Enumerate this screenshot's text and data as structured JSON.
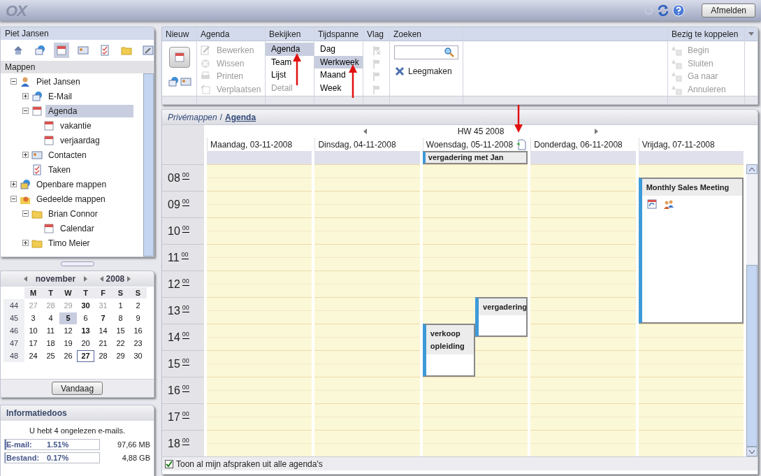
{
  "top_bar": {
    "logo": "OX",
    "logout": "Afmelden"
  },
  "sidebar": {
    "user": "Piet Jansen",
    "modules": [
      {
        "kind": "home",
        "selected": false
      },
      {
        "kind": "mail",
        "selected": false
      },
      {
        "kind": "calendar",
        "selected": true
      },
      {
        "kind": "contacts",
        "selected": false
      },
      {
        "kind": "tasks",
        "selected": false
      },
      {
        "kind": "folder",
        "selected": false
      },
      {
        "kind": "settings",
        "selected": false
      }
    ],
    "folders_title": "Mappen",
    "tree": [
      {
        "label": "Piet Jansen",
        "kind": "user",
        "expanded": true,
        "selected": false,
        "children": [
          {
            "label": "E-Mail",
            "kind": "mail",
            "expanded": false,
            "selected": false
          },
          {
            "label": "Agenda",
            "kind": "calendar",
            "expanded": true,
            "selected": true,
            "children": [
              {
                "label": "vakantie",
                "kind": "calendar",
                "selected": false
              },
              {
                "label": "verjaardag",
                "kind": "calendar",
                "selected": false
              }
            ]
          },
          {
            "label": "Contacten",
            "kind": "contacts",
            "expanded": false,
            "selected": false
          },
          {
            "label": "Taken",
            "kind": "tasks",
            "selected": false
          }
        ]
      },
      {
        "label": "Openbare mappen",
        "kind": "public",
        "expanded": false,
        "selected": false
      },
      {
        "label": "Gedeelde mappen",
        "kind": "shared",
        "expanded": true,
        "selected": false,
        "children": [
          {
            "label": "Brian Connor",
            "kind": "folder",
            "expanded": true,
            "selected": false,
            "children": [
              {
                "label": "Calendar",
                "kind": "calendar",
                "selected": false
              }
            ]
          },
          {
            "label": "Timo Meier",
            "kind": "folder",
            "expanded": false,
            "selected": false
          }
        ]
      }
    ]
  },
  "mini_calendar": {
    "month": "november",
    "year": "2008",
    "weekdays": [
      "M",
      "T",
      "W",
      "T",
      "F",
      "S",
      "S"
    ],
    "weeks": [
      {
        "number": "44",
        "days": [
          {
            "label": "27",
            "muted": true,
            "bold": false,
            "selected": false,
            "today": false
          },
          {
            "label": "28",
            "muted": true,
            "bold": false,
            "selected": false,
            "today": false
          },
          {
            "label": "29",
            "muted": true,
            "bold": false,
            "selected": false,
            "today": false
          },
          {
            "label": "30",
            "muted": false,
            "bold": true,
            "selected": false,
            "today": false
          },
          {
            "label": "31",
            "muted": true,
            "bold": false,
            "selected": false,
            "today": false
          },
          {
            "label": "1",
            "muted": false,
            "bold": false,
            "selected": false,
            "today": false
          },
          {
            "label": "2",
            "muted": false,
            "bold": false,
            "selected": false,
            "today": false
          }
        ]
      },
      {
        "number": "45",
        "days": [
          {
            "label": "3",
            "muted": false,
            "bold": false,
            "selected": false,
            "today": false
          },
          {
            "label": "4",
            "muted": false,
            "bold": false,
            "selected": false,
            "today": false
          },
          {
            "label": "5",
            "muted": false,
            "bold": true,
            "selected": true,
            "today": false
          },
          {
            "label": "6",
            "muted": false,
            "bold": false,
            "selected": false,
            "today": false
          },
          {
            "label": "7",
            "muted": false,
            "bold": true,
            "selected": false,
            "today": false
          },
          {
            "label": "8",
            "muted": false,
            "bold": false,
            "selected": false,
            "today": false
          },
          {
            "label": "9",
            "muted": false,
            "bold": false,
            "selected": false,
            "today": false
          }
        ]
      },
      {
        "number": "46",
        "days": [
          {
            "label": "10",
            "muted": false,
            "bold": false,
            "selected": false,
            "today": false
          },
          {
            "label": "11",
            "muted": false,
            "bold": false,
            "selected": false,
            "today": false
          },
          {
            "label": "12",
            "muted": false,
            "bold": false,
            "selected": false,
            "today": false
          },
          {
            "label": "13",
            "muted": false,
            "bold": true,
            "selected": false,
            "today": false
          },
          {
            "label": "14",
            "muted": false,
            "bold": false,
            "selected": false,
            "today": false
          },
          {
            "label": "15",
            "muted": false,
            "bold": false,
            "selected": false,
            "today": false
          },
          {
            "label": "16",
            "muted": false,
            "bold": false,
            "selected": false,
            "today": false
          }
        ]
      },
      {
        "number": "47",
        "days": [
          {
            "label": "17",
            "muted": false,
            "bold": false,
            "selected": false,
            "today": false
          },
          {
            "label": "18",
            "muted": false,
            "bold": false,
            "selected": false,
            "today": false
          },
          {
            "label": "19",
            "muted": false,
            "bold": false,
            "selected": false,
            "today": false
          },
          {
            "label": "20",
            "muted": false,
            "bold": false,
            "selected": false,
            "today": false
          },
          {
            "label": "21",
            "muted": false,
            "bold": false,
            "selected": false,
            "today": false
          },
          {
            "label": "22",
            "muted": false,
            "bold": false,
            "selected": false,
            "today": false
          },
          {
            "label": "23",
            "muted": false,
            "bold": false,
            "selected": false,
            "today": false
          }
        ]
      },
      {
        "number": "48",
        "days": [
          {
            "label": "24",
            "muted": false,
            "bold": false,
            "selected": false,
            "today": false
          },
          {
            "label": "25",
            "muted": false,
            "bold": false,
            "selected": false,
            "today": false
          },
          {
            "label": "26",
            "muted": false,
            "bold": false,
            "selected": false,
            "today": false
          },
          {
            "label": "27",
            "muted": false,
            "bold": true,
            "selected": false,
            "today": true
          },
          {
            "label": "28",
            "muted": false,
            "bold": false,
            "selected": false,
            "today": false
          },
          {
            "label": "29",
            "muted": false,
            "bold": false,
            "selected": false,
            "today": false
          },
          {
            "label": "30",
            "muted": false,
            "bold": false,
            "selected": false,
            "today": false
          }
        ]
      }
    ],
    "today_button": "Vandaag"
  },
  "info_box": {
    "title": "Informatiedoos",
    "message": "U hebt 4 ongelezen e-mails.",
    "quotas": [
      {
        "label": "E-mail:",
        "percent": "1.51%",
        "size": "97,66 MB",
        "level": 0.0151
      },
      {
        "label": "Bestand:",
        "percent": "0.17%",
        "size": "4,88 GB",
        "level": 0.0017
      }
    ]
  },
  "toolbar": {
    "groups": [
      {
        "title": "Nieuw",
        "kind": "new"
      },
      {
        "title": "Agenda",
        "kind": "actions",
        "items": [
          {
            "label": "Bewerken",
            "kind": "edit",
            "disabled": true
          },
          {
            "label": "Wissen",
            "kind": "delete",
            "disabled": true
          },
          {
            "label": "Printen",
            "kind": "print",
            "disabled": true
          },
          {
            "label": "Verplaatsen",
            "kind": "move",
            "disabled": true
          }
        ]
      },
      {
        "title": "Bekijken",
        "kind": "options",
        "items": [
          {
            "label": "Agenda",
            "selected": true,
            "disabled": false
          },
          {
            "label": "Team",
            "selected": false,
            "disabled": false
          },
          {
            "label": "Lijst",
            "selected": false,
            "disabled": false
          },
          {
            "label": "Detail",
            "selected": false,
            "disabled": true
          }
        ]
      },
      {
        "title": "Tijdspanne",
        "kind": "options",
        "items": [
          {
            "label": "Dag",
            "selected": false,
            "disabled": false
          },
          {
            "label": "Werkweek",
            "selected": true,
            "disabled": false
          },
          {
            "label": "Maand",
            "selected": false,
            "disabled": false
          },
          {
            "label": "Week",
            "selected": false,
            "disabled": false
          }
        ]
      },
      {
        "title": "Vlag",
        "kind": "flags",
        "items": [
          {
            "kind": "unflag",
            "disabled": true
          },
          {
            "kind": "flag",
            "disabled": true
          },
          {
            "kind": "flag",
            "disabled": true
          },
          {
            "kind": "flag",
            "disabled": true
          }
        ]
      },
      {
        "title": "Zoeken",
        "kind": "search",
        "clear": "Leegmaken"
      },
      {
        "title": "Bezig te koppelen",
        "kind": "actions",
        "items": [
          {
            "label": "Begin",
            "kind": "link",
            "disabled": true
          },
          {
            "label": "Sluiten",
            "kind": "link",
            "disabled": true
          },
          {
            "label": "Ga naar",
            "kind": "link",
            "disabled": true
          },
          {
            "label": "Annuleren",
            "kind": "link",
            "disabled": true
          }
        ]
      }
    ]
  },
  "calendar": {
    "breadcrumb": {
      "folder": "Privémappen",
      "separator": "/",
      "current": "Agenda"
    },
    "week": "HW 45 2008",
    "days": [
      {
        "name": "Maandag, 03-11-2008",
        "note": false
      },
      {
        "name": "Dinsdag, 04-11-2008",
        "note": false
      },
      {
        "name": "Woensdag, 05-11-2008",
        "note": true,
        "all_day": [
          {
            "title": "vergadering met Jan"
          }
        ],
        "events": [
          {
            "title": "vergadering",
            "recurring": false,
            "participants": false
          },
          {
            "title": "verkoop opleiding",
            "recurring": false,
            "participants": false
          }
        ]
      },
      {
        "name": "Donderdag, 06-11-2008",
        "note": false
      },
      {
        "name": "Vrijdag, 07-11-2008",
        "note": false,
        "events": [
          {
            "title": "Monthly Sales Meeting",
            "recurring": true,
            "participants": true
          }
        ]
      }
    ],
    "hours": [
      {
        "hour": "08",
        "minutes": "00"
      },
      {
        "hour": "09",
        "minutes": "00"
      },
      {
        "hour": "10",
        "minutes": "00"
      },
      {
        "hour": "11",
        "minutes": "00"
      },
      {
        "hour": "12",
        "minutes": "00"
      },
      {
        "hour": "13",
        "minutes": "00"
      },
      {
        "hour": "14",
        "minutes": "00"
      },
      {
        "hour": "15",
        "minutes": "00"
      },
      {
        "hour": "16",
        "minutes": "00"
      },
      {
        "hour": "17",
        "minutes": "00"
      },
      {
        "hour": "18",
        "minutes": "00"
      }
    ],
    "show_all": {
      "label": "Toon al mijn afspraken uit alle agenda's",
      "checked": true
    }
  }
}
